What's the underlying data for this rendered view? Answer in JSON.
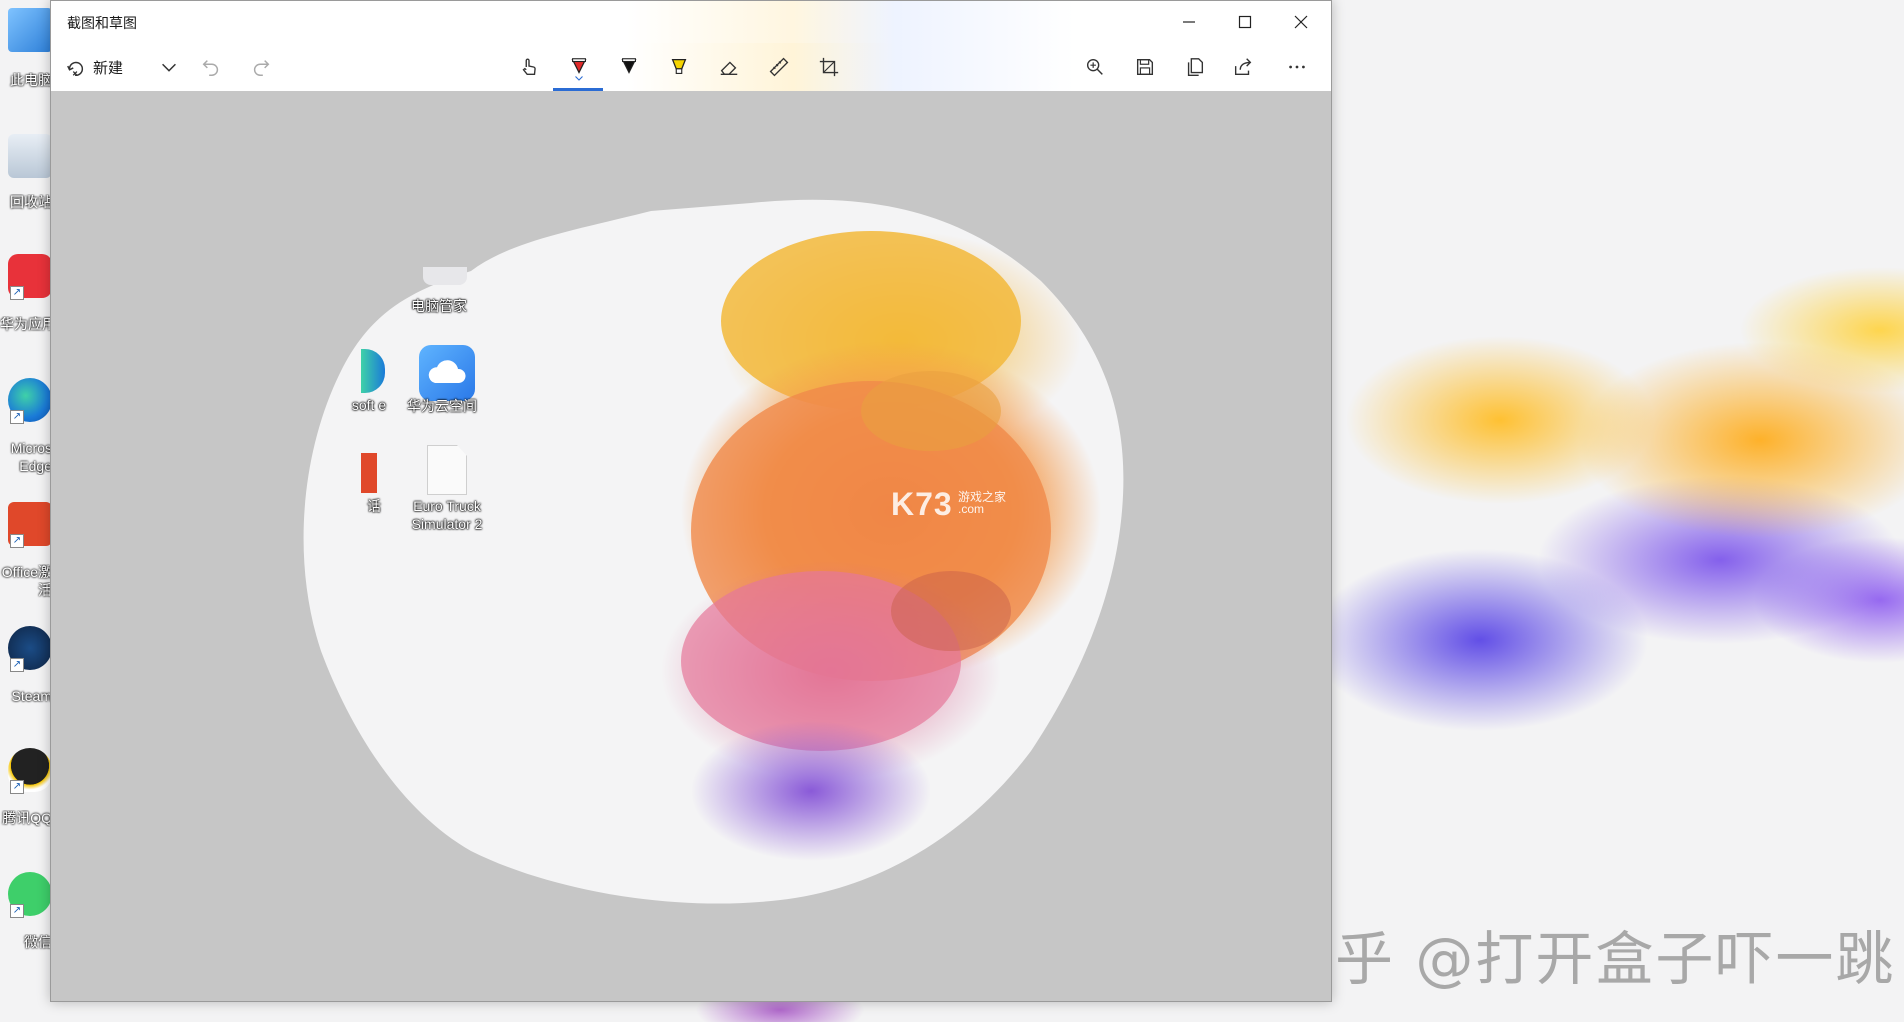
{
  "window": {
    "title": "截图和草图",
    "controls": {
      "minimize": "minimize-icon",
      "maximize": "maximize-icon",
      "close": "close-icon"
    }
  },
  "toolbar": {
    "new_label": "新建",
    "accent_color": "#2b6cd4",
    "left_tools": [
      "new-snip-icon",
      "chevron-down-icon",
      "undo-icon",
      "redo-icon"
    ],
    "center_tools": [
      "touch-writing-icon",
      "ballpoint-pen-icon",
      "pencil-icon",
      "highlighter-icon",
      "eraser-icon",
      "ruler-icon",
      "crop-icon"
    ],
    "right_tools": [
      "zoom-icon",
      "save-icon",
      "copy-icon",
      "share-icon",
      "more-icon"
    ],
    "selected_tool": "ballpoint-pen-icon"
  },
  "snip": {
    "icons": [
      {
        "label": "电脑管家"
      },
      {
        "label": "soft e"
      },
      {
        "label": "华为云空间"
      },
      {
        "label": "话"
      },
      {
        "label": "Euro Truck",
        "label2": "Simulator 2"
      }
    ],
    "watermark_logo": "K73",
    "watermark_sub1": "游戏之家",
    "watermark_sub2": ".com"
  },
  "desktop": {
    "icons": [
      {
        "label": "此电脑"
      },
      {
        "label": "回收站"
      },
      {
        "label": "华为应用"
      },
      {
        "label": "Micros",
        "label2": "Edge"
      },
      {
        "label": "Office激",
        "label2": "活"
      },
      {
        "label": "Steam"
      },
      {
        "label": "腾讯QQ"
      },
      {
        "label": "微信"
      }
    ],
    "watermark": "知乎 @打开盒子吓一跳"
  }
}
